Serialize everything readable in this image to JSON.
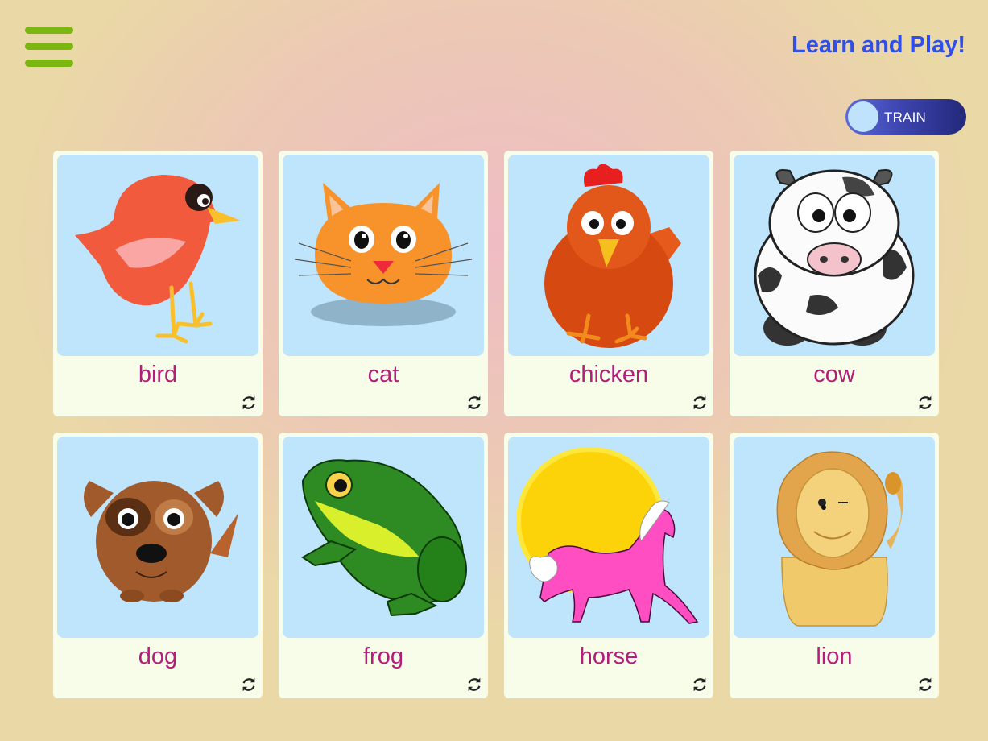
{
  "header": {
    "menu_icon": "hamburger-menu-icon",
    "title": "Learn and Play!",
    "mode_toggle": {
      "label": "TRAIN",
      "on": true
    }
  },
  "colors": {
    "menu": "#7cb610",
    "title": "#2f4fe8",
    "label": "#b21e79",
    "card": "#f7fde9",
    "image_bg": "#bfe5fc"
  },
  "cards": [
    {
      "label": "bird",
      "icon": "bird-icon",
      "flip_icon": "flip-icon"
    },
    {
      "label": "cat",
      "icon": "cat-icon",
      "flip_icon": "flip-icon"
    },
    {
      "label": "chicken",
      "icon": "chicken-icon",
      "flip_icon": "flip-icon"
    },
    {
      "label": "cow",
      "icon": "cow-icon",
      "flip_icon": "flip-icon"
    },
    {
      "label": "dog",
      "icon": "dog-icon",
      "flip_icon": "flip-icon"
    },
    {
      "label": "frog",
      "icon": "frog-icon",
      "flip_icon": "flip-icon"
    },
    {
      "label": "horse",
      "icon": "horse-icon",
      "flip_icon": "flip-icon"
    },
    {
      "label": "lion",
      "icon": "lion-icon",
      "flip_icon": "flip-icon"
    }
  ]
}
